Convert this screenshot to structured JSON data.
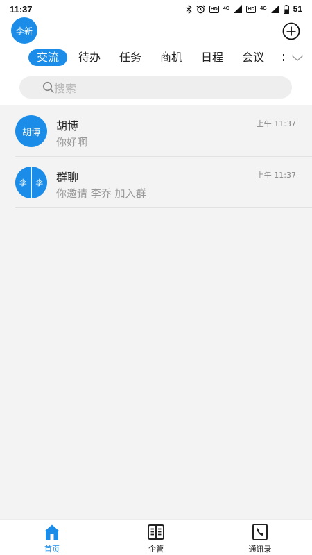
{
  "status_bar": {
    "time": "11:37",
    "network_1": "4G",
    "network_2": "4G",
    "hd_1": "HD",
    "hd_2": "HD",
    "battery": "51"
  },
  "header": {
    "user_avatar_text": "李新"
  },
  "tabs": [
    {
      "label": "交流",
      "active": true
    },
    {
      "label": "待办"
    },
    {
      "label": "任务"
    },
    {
      "label": "商机"
    },
    {
      "label": "日程"
    },
    {
      "label": "会议"
    }
  ],
  "search": {
    "placeholder": "搜索"
  },
  "conversations": [
    {
      "name": "胡博",
      "avatar_text": "胡博",
      "preview": "你好啊",
      "time": "上午 11:37"
    },
    {
      "name": "群聊",
      "avatar_left": "李",
      "avatar_right": "李",
      "preview": "你邀请 李乔 加入群",
      "time": "上午 11:37"
    }
  ],
  "bottom_nav": [
    {
      "label": "首页",
      "icon": "home-icon",
      "active": true
    },
    {
      "label": "企管",
      "icon": "book-icon"
    },
    {
      "label": "通讯录",
      "icon": "contacts-phone-icon"
    }
  ],
  "colors": {
    "accent": "#1b8de8",
    "list_background": "#f3f3f3",
    "muted_text": "#999999"
  }
}
